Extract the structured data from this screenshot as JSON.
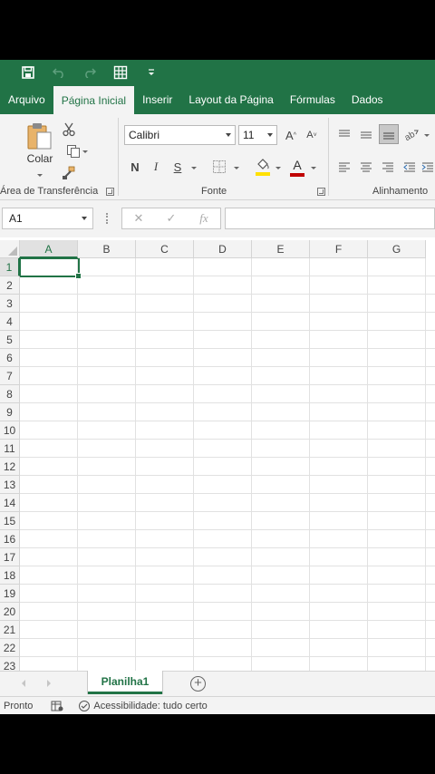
{
  "qat": {
    "icons": [
      "save-icon",
      "undo-icon",
      "redo-icon",
      "form-icon",
      "customize-icon"
    ]
  },
  "tabs": [
    "Arquivo",
    "Página Inicial",
    "Inserir",
    "Layout da Página",
    "Fórmulas",
    "Dados"
  ],
  "active_tab": "Página Inicial",
  "ribbon": {
    "clipboard": {
      "paste_label": "Colar",
      "group_label": "Área de Transferência"
    },
    "font": {
      "font_name": "Calibri",
      "font_size": "11",
      "bold": "N",
      "italic": "I",
      "underline": "S",
      "group_label": "Fonte"
    },
    "alignment": {
      "group_label": "Alinhamento"
    }
  },
  "formula_bar": {
    "name_box": "A1",
    "cancel_glyph": "✕",
    "enter_glyph": "✓",
    "fx_glyph": "fx",
    "value": ""
  },
  "grid": {
    "columns": [
      "A",
      "B",
      "C",
      "D",
      "E",
      "F",
      "G"
    ],
    "rows": [
      "1",
      "2",
      "3",
      "4",
      "5",
      "6",
      "7",
      "8",
      "9",
      "10",
      "11",
      "12",
      "13",
      "14",
      "15",
      "16",
      "17",
      "18",
      "19",
      "20",
      "21",
      "22",
      "23"
    ],
    "active_cell": "A1"
  },
  "sheets": {
    "tabs": [
      "Planilha1"
    ],
    "add_glyph": "+"
  },
  "status": {
    "ready": "Pronto",
    "accessibility": "Acessibilidade: tudo certo"
  },
  "colors": {
    "accent": "#217346",
    "ribbon_bg": "#f3f3f3",
    "font_color": "#c00000",
    "highlight": "#ffe000"
  }
}
